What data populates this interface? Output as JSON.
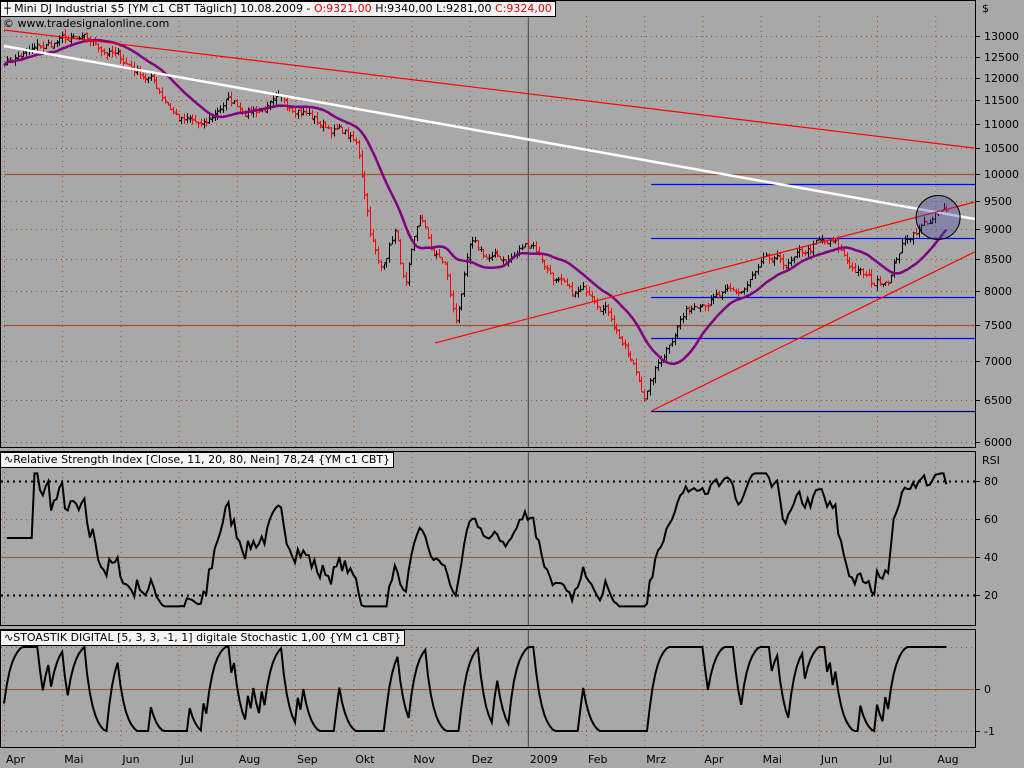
{
  "header": {
    "instrument": "Mini DJ Industrial $5 [YM c1 CBT  Täglich]",
    "date": "10.08.2009 -",
    "open": "O:9321,00",
    "high": "H:9340,00",
    "low": "L:9281,00",
    "close": "C:9324,00",
    "copyright": "© www.tradesignalonline.com",
    "currency": "$"
  },
  "rsi_panel": {
    "title": "Relative Strength Index [Close, 11, 20, 80, Nein] 78,24 {YM c1 CBT}",
    "axis_title": "RSI"
  },
  "stoch_panel": {
    "title": "STOASTIK DIGITAL [5, 3, 3, -1, 1] digitale Stochastic 1,00 {YM c1 CBT}"
  },
  "colors": {
    "background": "#a8a8a8",
    "up_bar": "#000000",
    "down_bar": "#ff0000",
    "moving_average": "#800080",
    "trendline": "#ff0000",
    "long_trendline": "#ffffff",
    "levels": "#0000ff",
    "grid": "#a0522d"
  },
  "chart_data": {
    "type": "line",
    "scale": "log",
    "x_ticks": [
      "Apr",
      "Mai",
      "Jun",
      "Jul",
      "Aug",
      "Sep",
      "Okt",
      "Nov",
      "Dez",
      "2009",
      "Feb",
      "Mrz",
      "Apr",
      "Mai",
      "Jun",
      "Jul",
      "Aug"
    ],
    "price_ticks": [
      "13000",
      "12500",
      "12000",
      "11500",
      "11000",
      "10500",
      "10000",
      "9500",
      "9000",
      "8500",
      "8000",
      "7500",
      "7000",
      "6500",
      "6000"
    ],
    "rsi_ticks": [
      "80",
      "60",
      "40",
      "20"
    ],
    "stoch_ticks": [
      "0",
      "-1"
    ],
    "price_close_approx": [
      [
        0,
        12400
      ],
      [
        0.45,
        12600
      ],
      [
        1.03,
        12900
      ],
      [
        1.56,
        12800
      ],
      [
        2.04,
        12400
      ],
      [
        2.51,
        12000
      ],
      [
        3.02,
        11100
      ],
      [
        3.45,
        10900
      ],
      [
        3.8,
        11500
      ],
      [
        4.23,
        11300
      ],
      [
        4.66,
        11400
      ],
      [
        5.05,
        11400
      ],
      [
        5.43,
        11000
      ],
      [
        5.86,
        10800
      ],
      [
        6.07,
        10500
      ],
      [
        6.29,
        9000
      ],
      [
        6.46,
        8300
      ],
      [
        6.72,
        9000
      ],
      [
        6.89,
        8000
      ],
      [
        7.15,
        9200
      ],
      [
        7.35,
        8600
      ],
      [
        7.58,
        8400
      ],
      [
        7.75,
        7500
      ],
      [
        8.01,
        8700
      ],
      [
        8.35,
        8500
      ],
      [
        8.69,
        8500
      ],
      [
        9.07,
        8800
      ],
      [
        9.38,
        8300
      ],
      [
        9.73,
        7900
      ],
      [
        10.1,
        8000
      ],
      [
        10.41,
        7700
      ],
      [
        10.76,
        7000
      ],
      [
        11.01,
        6550
      ],
      [
        11.27,
        7000
      ],
      [
        11.62,
        7600
      ],
      [
        11.96,
        7900
      ],
      [
        12.3,
        7900
      ],
      [
        12.65,
        7950
      ],
      [
        13.04,
        8400
      ],
      [
        13.5,
        8400
      ],
      [
        13.97,
        8750
      ],
      [
        14.28,
        8700
      ],
      [
        14.54,
        8400
      ],
      [
        14.93,
        8100
      ],
      [
        15.22,
        8250
      ],
      [
        15.4,
        8700
      ],
      [
        15.65,
        9000
      ],
      [
        16.0,
        9200
      ],
      [
        16.22,
        9324
      ]
    ],
    "trendlines": [
      {
        "name": "long-resistance",
        "color": "#ff0000",
        "from": [
          0,
          13150
        ],
        "to": [
          16.68,
          10500
        ]
      },
      {
        "name": "white-resistance",
        "color": "#ffffff",
        "from": [
          0,
          12755
        ],
        "to": [
          16.68,
          9174
        ]
      },
      {
        "name": "wedge-upper",
        "color": "#ff0000",
        "from": [
          7.41,
          7245
        ],
        "to": [
          16.68,
          9476
        ]
      },
      {
        "name": "wedge-lower",
        "color": "#ff0000",
        "from": [
          11.12,
          6364
        ],
        "to": [
          16.68,
          8617
        ]
      }
    ],
    "levels": [
      {
        "price": 9810,
        "color": "#0000ff",
        "from": 11.12
      },
      {
        "price": 8848,
        "color": "#0000ff",
        "from": 11.12
      },
      {
        "price": 7908,
        "color": "#0000ff",
        "from": 11.12
      },
      {
        "price": 7314,
        "color": "#0000ff",
        "from": 11.12
      },
      {
        "price": 6364,
        "color": "#000080",
        "from": 11.12
      },
      {
        "price": 10000,
        "color": "#a0522d",
        "from": 0
      },
      {
        "price": 7500,
        "color": "#a0522d",
        "from": 0
      }
    ],
    "highlight_circle": {
      "at": [
        16.05,
        9200
      ]
    },
    "moving_average_period": 20,
    "rsi_period": 11,
    "rsi_levels": [
      20,
      80
    ],
    "last_rsi": 78.24,
    "last_stoch": 1.0
  }
}
